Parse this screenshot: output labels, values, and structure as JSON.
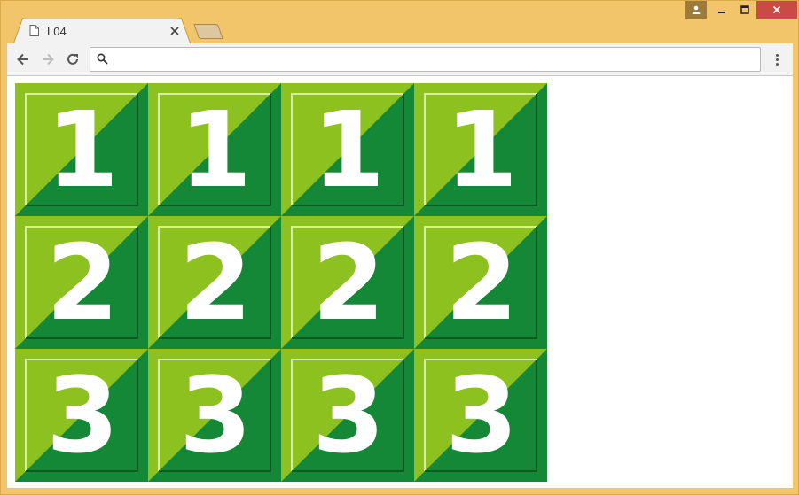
{
  "window": {
    "colors": {
      "frame": "#f2c56a",
      "close": "#c94b45",
      "profile": "#9b7a3a"
    },
    "profile_icon": "person-icon",
    "minimize_icon": "minimize-icon",
    "maximize_icon": "maximize-icon",
    "close_icon": "close-icon"
  },
  "tab": {
    "title": "L04",
    "icon": "page-icon",
    "close_icon": "close-icon"
  },
  "toolbar": {
    "back_icon": "back-arrow-icon",
    "forward_icon": "forward-arrow-icon",
    "reload_icon": "reload-icon",
    "menu_icon": "more-vert-icon",
    "omnibox": {
      "value": "",
      "icon": "search-icon"
    }
  },
  "page": {
    "colors": {
      "light_green": "#8dc11f",
      "dark_green": "#148837",
      "digit": "#ffffff"
    },
    "rows": [
      [
        "1",
        "1",
        "1",
        "1"
      ],
      [
        "2",
        "2",
        "2",
        "2"
      ],
      [
        "3",
        "3",
        "3",
        "3"
      ]
    ]
  }
}
